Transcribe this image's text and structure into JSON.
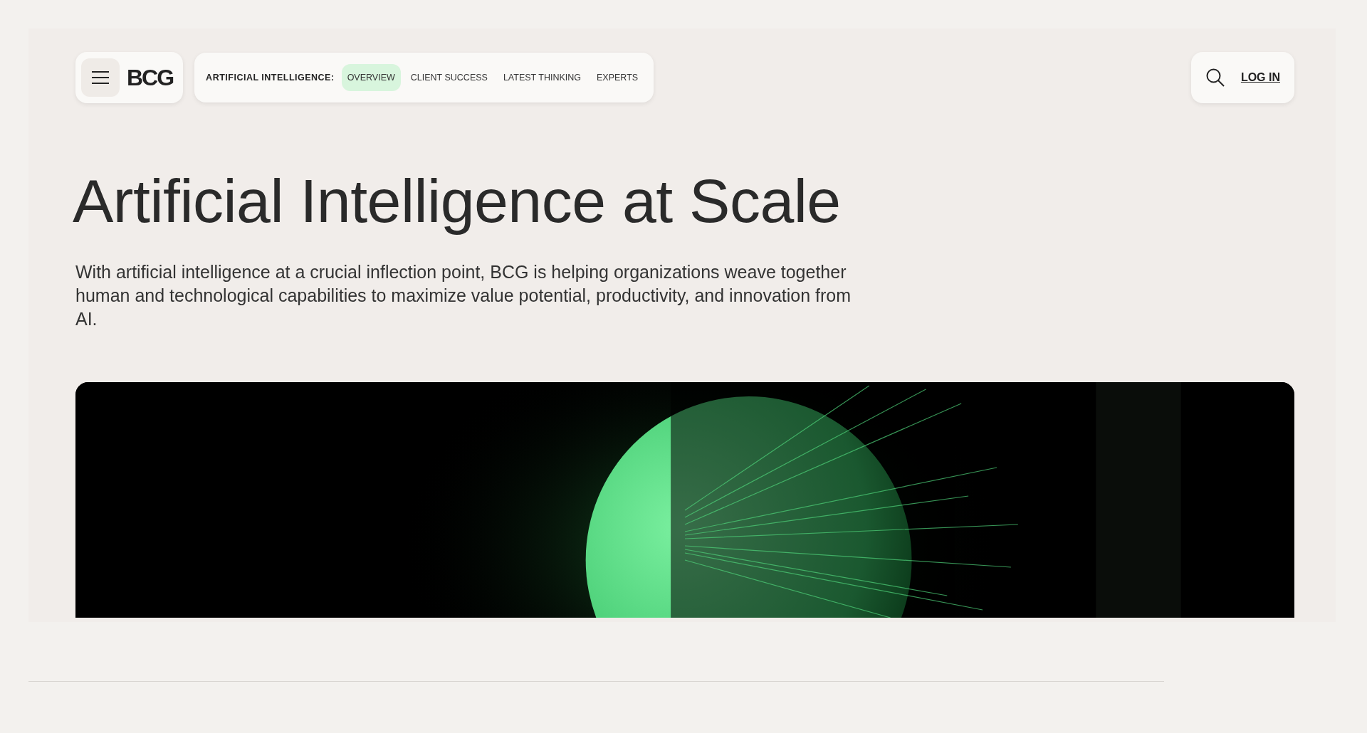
{
  "header": {
    "logo": "BCG",
    "section_label": "ARTIFICIAL INTELLIGENCE:",
    "tabs": [
      {
        "label": "OVERVIEW",
        "selected": true
      },
      {
        "label": "CLIENT SUCCESS",
        "selected": false
      },
      {
        "label": "LATEST THINKING",
        "selected": false
      },
      {
        "label": "EXPERTS",
        "selected": false
      }
    ],
    "login": "LOG IN"
  },
  "hero": {
    "title": "Artificial Intelligence at Scale",
    "description": "With artificial intelligence at a crucial inflection point, BCG is helping organizations weave together human and technological capabilities to maximize value potential, productivity, and innovation from AI."
  }
}
